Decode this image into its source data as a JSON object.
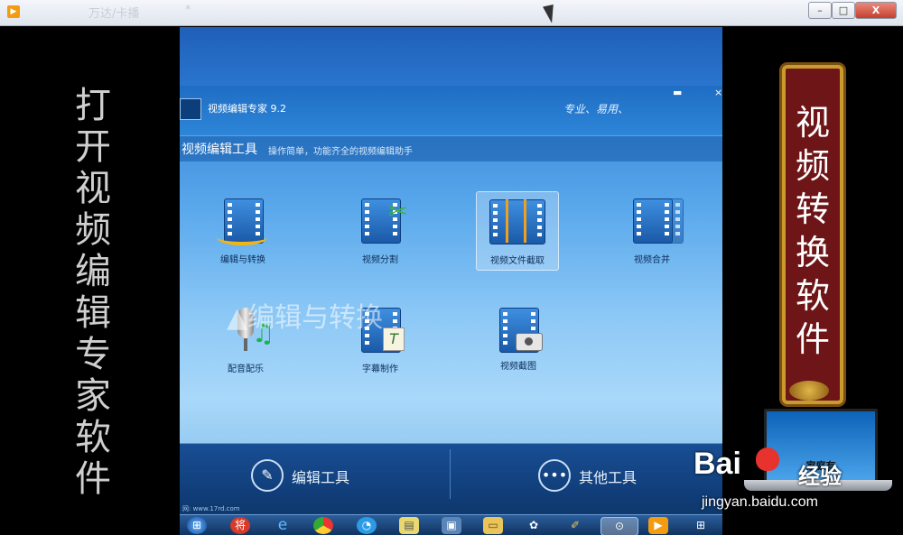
{
  "window": {
    "app_icon": "player-icon",
    "faded_tab_text": "万达/卡播",
    "faded_tab_star": "*",
    "btn_min": "–",
    "btn_max": "□",
    "btn_close": "X"
  },
  "left_caption": "打开视频编辑专家软件",
  "right_caption": "视频转换软件",
  "app": {
    "title": "视频编辑专家 9.2",
    "slogan": "专业、易用、",
    "header_btns": [
      "▬",
      "×"
    ],
    "section_title": "视频编辑工具",
    "section_desc": "操作简单，功能齐全的视频编辑助手",
    "tools": [
      {
        "label": "编辑与转换",
        "icon": "edit-convert-icon"
      },
      {
        "label": "视频分割",
        "icon": "scissors-film-icon"
      },
      {
        "label": "视频文件截取",
        "icon": "film-trim-icon"
      },
      {
        "label": "视频合并",
        "icon": "film-merge-icon"
      },
      {
        "label": "配音配乐",
        "icon": "microphone-music-icon"
      },
      {
        "label": "字幕制作",
        "icon": "subtitle-icon"
      },
      {
        "label": "视频截图",
        "icon": "camera-film-icon"
      }
    ],
    "watermark": "▲编辑与转换",
    "tabs": [
      {
        "label": "编辑工具",
        "icon": "pencil-icon"
      },
      {
        "label": "其他工具",
        "icon": "more-dots-icon"
      }
    ],
    "status_text": "网: www.17rd.com"
  },
  "taskbar": [
    "start-orb-icon",
    "jiang-icon",
    "ie-icon",
    "chrome-icon",
    "browser-icon",
    "note-icon",
    "remote-icon",
    "folder-icon",
    "pinwheel-icon",
    "paint-icon",
    "player-active-icon",
    "video-icon",
    "windows-flag-icon"
  ],
  "laptop_text": "家庭有",
  "baidu": {
    "brand": "Bai",
    "brand2": "经验",
    "url": "jingyan.baidu.com"
  },
  "colors": {
    "app_blue": "#2f82d6",
    "scroll_red": "#6e1518",
    "gold": "#c99a2e"
  }
}
